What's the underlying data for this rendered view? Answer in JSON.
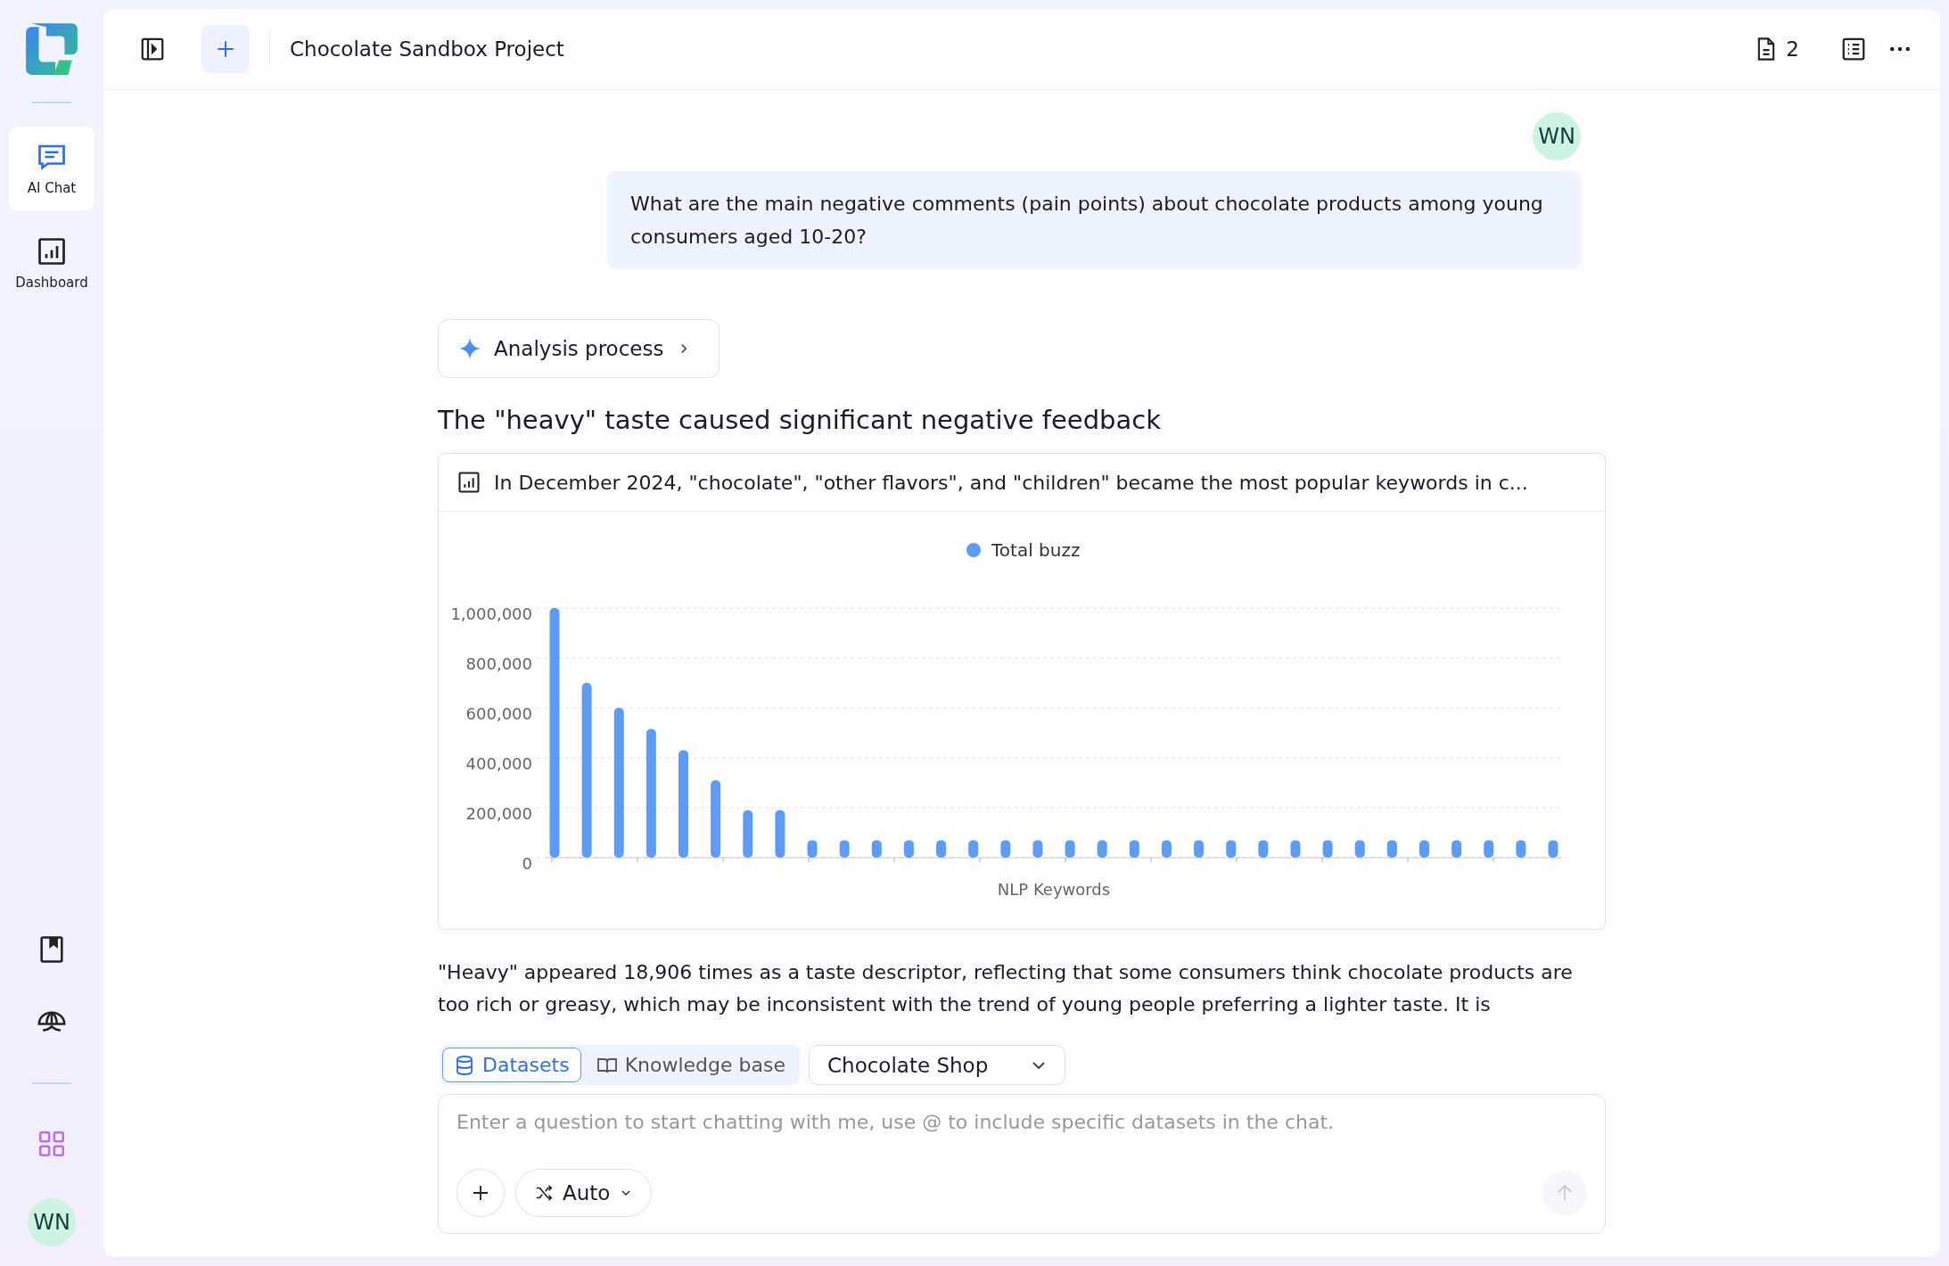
{
  "sidebar": {
    "nav": [
      {
        "kind": "chat",
        "label": "AI Chat",
        "selected": true
      },
      {
        "kind": "dashboard",
        "label": "Dashboard",
        "selected": false
      }
    ],
    "avatar": "WN"
  },
  "header": {
    "title": "Chocolate Sandbox Project",
    "doc_count": "2"
  },
  "conversation": {
    "user_avatar": "WN",
    "question": "What are the main negative comments (pain points) about chocolate products among young consumers aged 10-20?",
    "analysis_button": "Analysis process",
    "heading": "The \"heavy\" taste caused significant negative feedback",
    "chart_card": {
      "title": "In December 2024, \"chocolate\", \"other flavors\", and \"children\" became the most popular keywords in c...",
      "chart_data": {
        "type": "bar",
        "grid": true,
        "xlabel": "NLP Keywords",
        "ylim": [
          0,
          1000000
        ],
        "yticks": [
          {
            "value": 0,
            "label": "0"
          },
          {
            "value": 200000,
            "label": "200,000"
          },
          {
            "value": 400000,
            "label": "400,000"
          },
          {
            "value": 600000,
            "label": "600,000"
          },
          {
            "value": 800000,
            "label": "800,000"
          },
          {
            "value": 1000000,
            "label": "1,000,000"
          }
        ],
        "series": [
          {
            "name": "Total buzz",
            "color": "#5b9cf8",
            "values": [
              1000000,
              700000,
              600000,
              515000,
              430000,
              310000,
              190000,
              190000,
              70000,
              70000,
              70000,
              70000,
              70000,
              70000,
              70000,
              70000,
              70000,
              70000,
              70000,
              70000,
              70000,
              70000,
              70000,
              70000,
              70000,
              70000,
              70000,
              70000,
              70000,
              70000,
              70000,
              70000
            ]
          }
        ]
      }
    },
    "paragraph": "\"Heavy\" appeared 18,906 times as a taste descriptor, reflecting that some consumers think chocolate products are too rich or greasy, which may be inconsistent with the trend of young people preferring a lighter taste. It is"
  },
  "composer": {
    "source_tabs": [
      {
        "label": "Datasets",
        "selected": true
      },
      {
        "label": "Knowledge base",
        "selected": false
      }
    ],
    "dataset_select": "Chocolate Shop",
    "placeholder": "Enter a question to start chatting with me, use @ to include specific datasets in the chat.",
    "mode": "Auto"
  }
}
